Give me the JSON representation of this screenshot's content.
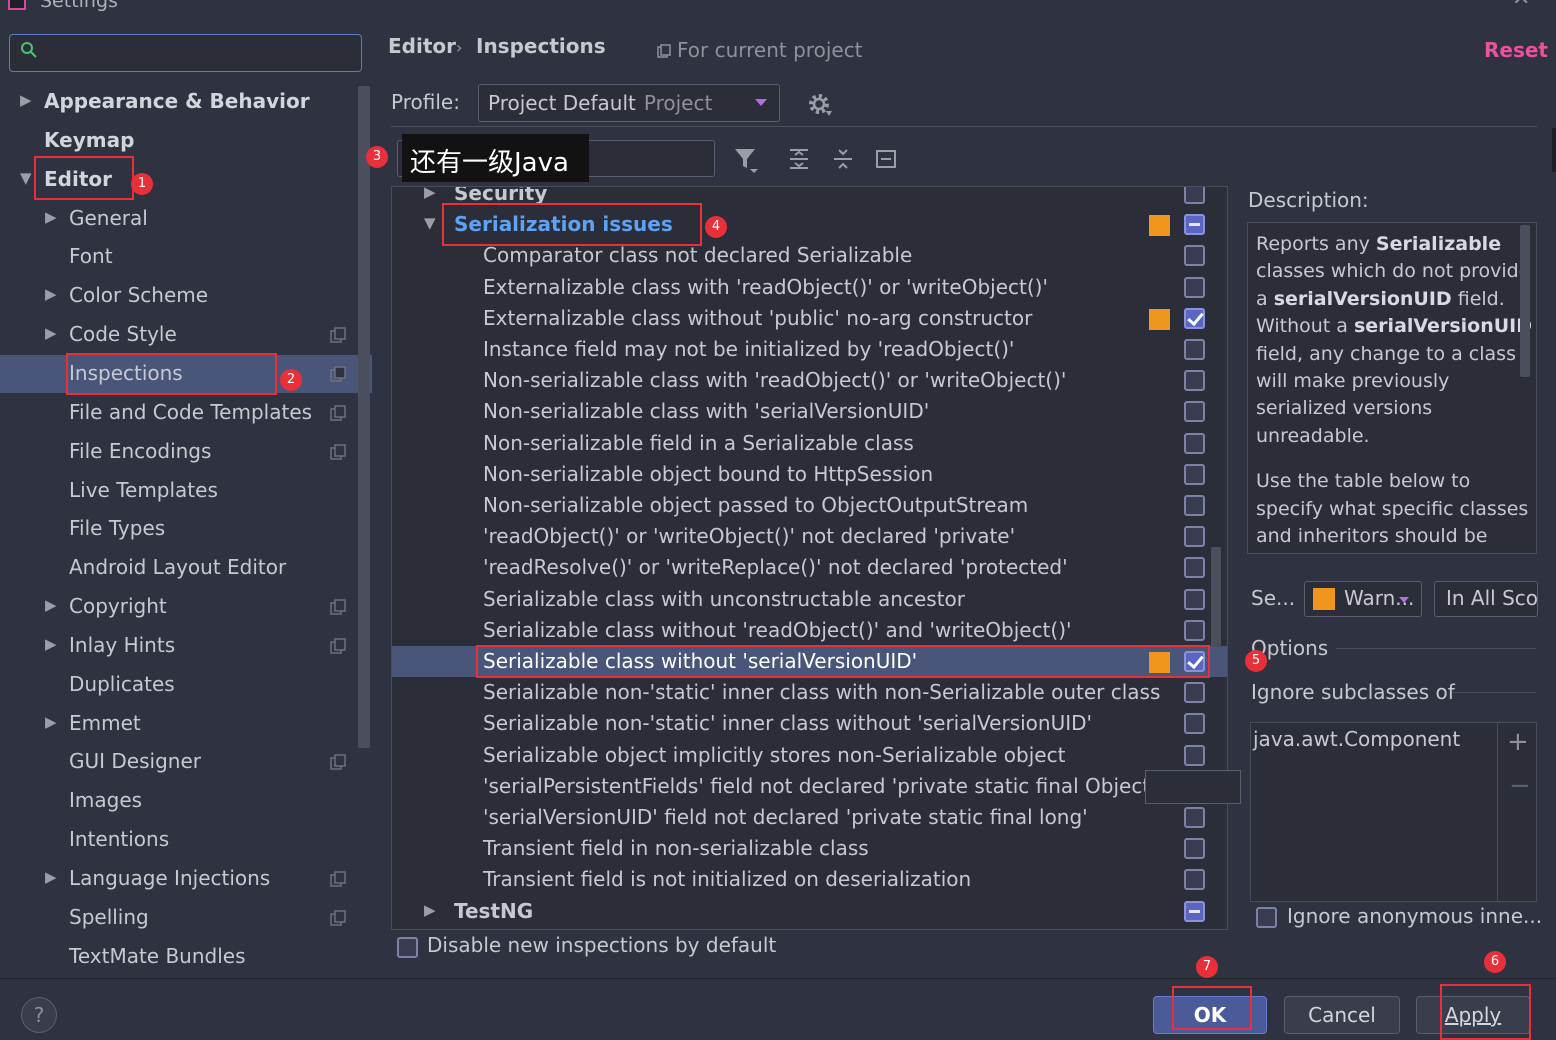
{
  "window": {
    "title": "Settings"
  },
  "search": {
    "placeholder": ""
  },
  "sidebar": {
    "items": [
      {
        "label": "Appearance & Behavior",
        "level": 0,
        "arrow": "right",
        "bold": true
      },
      {
        "label": "Keymap",
        "level": 0,
        "arrow": "",
        "bold": true
      },
      {
        "label": "Editor",
        "level": 0,
        "arrow": "down",
        "bold": true
      },
      {
        "label": "General",
        "level": 1,
        "arrow": "right"
      },
      {
        "label": "Font",
        "level": 1,
        "arrow": ""
      },
      {
        "label": "Color Scheme",
        "level": 1,
        "arrow": "right"
      },
      {
        "label": "Code Style",
        "level": 1,
        "arrow": "right",
        "project": true
      },
      {
        "label": "Inspections",
        "level": 1,
        "arrow": "",
        "project": true,
        "selected": true
      },
      {
        "label": "File and Code Templates",
        "level": 1,
        "arrow": "",
        "project": true
      },
      {
        "label": "File Encodings",
        "level": 1,
        "arrow": "",
        "project": true
      },
      {
        "label": "Live Templates",
        "level": 1,
        "arrow": ""
      },
      {
        "label": "File Types",
        "level": 1,
        "arrow": ""
      },
      {
        "label": "Android Layout Editor",
        "level": 1,
        "arrow": ""
      },
      {
        "label": "Copyright",
        "level": 1,
        "arrow": "right",
        "project": true
      },
      {
        "label": "Inlay Hints",
        "level": 1,
        "arrow": "right",
        "project": true
      },
      {
        "label": "Duplicates",
        "level": 1,
        "arrow": ""
      },
      {
        "label": "Emmet",
        "level": 1,
        "arrow": "right"
      },
      {
        "label": "GUI Designer",
        "level": 1,
        "arrow": "",
        "project": true
      },
      {
        "label": "Images",
        "level": 1,
        "arrow": ""
      },
      {
        "label": "Intentions",
        "level": 1,
        "arrow": ""
      },
      {
        "label": "Language Injections",
        "level": 1,
        "arrow": "right",
        "project": true
      },
      {
        "label": "Spelling",
        "level": 1,
        "arrow": "",
        "project": true
      },
      {
        "label": "TextMate Bundles",
        "level": 1,
        "arrow": ""
      }
    ]
  },
  "header": {
    "breadcrumb_root": "Editor",
    "breadcrumb_sep": "›",
    "breadcrumb_current": "Inspections",
    "scope_note": "For current project",
    "reset_label": "Reset"
  },
  "profile": {
    "label": "Profile:",
    "value": "Project Default",
    "sub": "Project"
  },
  "filter": {
    "value": "",
    "tooltip": "还有一级Java"
  },
  "inspections": {
    "rows": [
      {
        "label": "Security",
        "type": "group",
        "arrow": "right",
        "cb": "unchecked",
        "sev": false
      },
      {
        "label": "Serialization issues",
        "type": "group",
        "arrow": "down",
        "cb": "partial",
        "sev": true,
        "highlight": true
      },
      {
        "label": "Comparator class not declared Serializable",
        "cb": "unchecked",
        "sev": false
      },
      {
        "label": "Externalizable class with 'readObject()' or 'writeObject()'",
        "cb": "unchecked",
        "sev": false
      },
      {
        "label": "Externalizable class without 'public' no-arg constructor",
        "cb": "checked",
        "sev": true
      },
      {
        "label": "Instance field may not be initialized by 'readObject()'",
        "cb": "unchecked",
        "sev": false
      },
      {
        "label": "Non-serializable class with 'readObject()' or 'writeObject()'",
        "cb": "unchecked",
        "sev": false
      },
      {
        "label": "Non-serializable class with 'serialVersionUID'",
        "cb": "unchecked",
        "sev": false
      },
      {
        "label": "Non-serializable field in a Serializable class",
        "cb": "unchecked",
        "sev": false
      },
      {
        "label": "Non-serializable object bound to HttpSession",
        "cb": "unchecked",
        "sev": false
      },
      {
        "label": "Non-serializable object passed to ObjectOutputStream",
        "cb": "unchecked",
        "sev": false
      },
      {
        "label": "'readObject()' or 'writeObject()' not declared 'private'",
        "cb": "unchecked",
        "sev": false
      },
      {
        "label": "'readResolve()' or 'writeReplace()' not declared 'protected'",
        "cb": "unchecked",
        "sev": false
      },
      {
        "label": "Serializable class with unconstructable ancestor",
        "cb": "unchecked",
        "sev": false
      },
      {
        "label": "Serializable class without 'readObject()' and 'writeObject()'",
        "cb": "unchecked",
        "sev": false
      },
      {
        "label": "Serializable class without 'serialVersionUID'",
        "cb": "checked",
        "sev": true,
        "selected": true
      },
      {
        "label": "Serializable non-'static' inner class with non-Serializable outer class",
        "cb": "unchecked",
        "sev": false
      },
      {
        "label": "Serializable non-'static' inner class without 'serialVersionUID'",
        "cb": "unchecked",
        "sev": false
      },
      {
        "label": "Serializable object implicitly stores non-Serializable object",
        "cb": "unchecked",
        "sev": false
      },
      {
        "label": "'serialPersistentFields' field not declared 'private static final ObjectStreamField[]'",
        "cb": "none",
        "sev": false
      },
      {
        "label": "'serialVersionUID' field not declared 'private static final long'",
        "cb": "unchecked",
        "sev": false
      },
      {
        "label": "Transient field in non-serializable class",
        "cb": "unchecked",
        "sev": false
      },
      {
        "label": "Transient field is not initialized on deserialization",
        "cb": "unchecked",
        "sev": false
      },
      {
        "label": "TestNG",
        "type": "group",
        "arrow": "right",
        "cb": "partial",
        "sev": false
      }
    ]
  },
  "disable_new": {
    "label": "Disable new inspections by default"
  },
  "description": {
    "label": "Description:",
    "p1_parts": [
      "Reports any ",
      "Serializable",
      " classes which do not provide a ",
      "serialVersionUID",
      " field. Without a ",
      "serialVersionUID",
      " field, any change to a class will make previously serialized versions unreadable."
    ],
    "p2": "Use the table below to specify what specific classes and inheritors should be"
  },
  "severity": {
    "label": "Se...",
    "value": "Warn...",
    "scope": "In All Sco...",
    "color": "#f0961e"
  },
  "options": {
    "label": "Options",
    "ignore_sub_label": "Ignore subclasses of",
    "ignore_items": [
      "java.awt.Component"
    ],
    "add": "+",
    "remove": "−",
    "ignore_anon_label": "Ignore anonymous inne..."
  },
  "buttons": {
    "help": "?",
    "ok": "OK",
    "cancel": "Cancel",
    "apply": "Apply"
  },
  "annotations": [
    "1",
    "2",
    "3",
    "4",
    "5",
    "6",
    "7"
  ],
  "colors": {
    "accent": "#5a66c2",
    "selection": "#4a5679",
    "warning": "#f0961e",
    "reset": "#e8539b",
    "annotation": "#e8303a"
  }
}
